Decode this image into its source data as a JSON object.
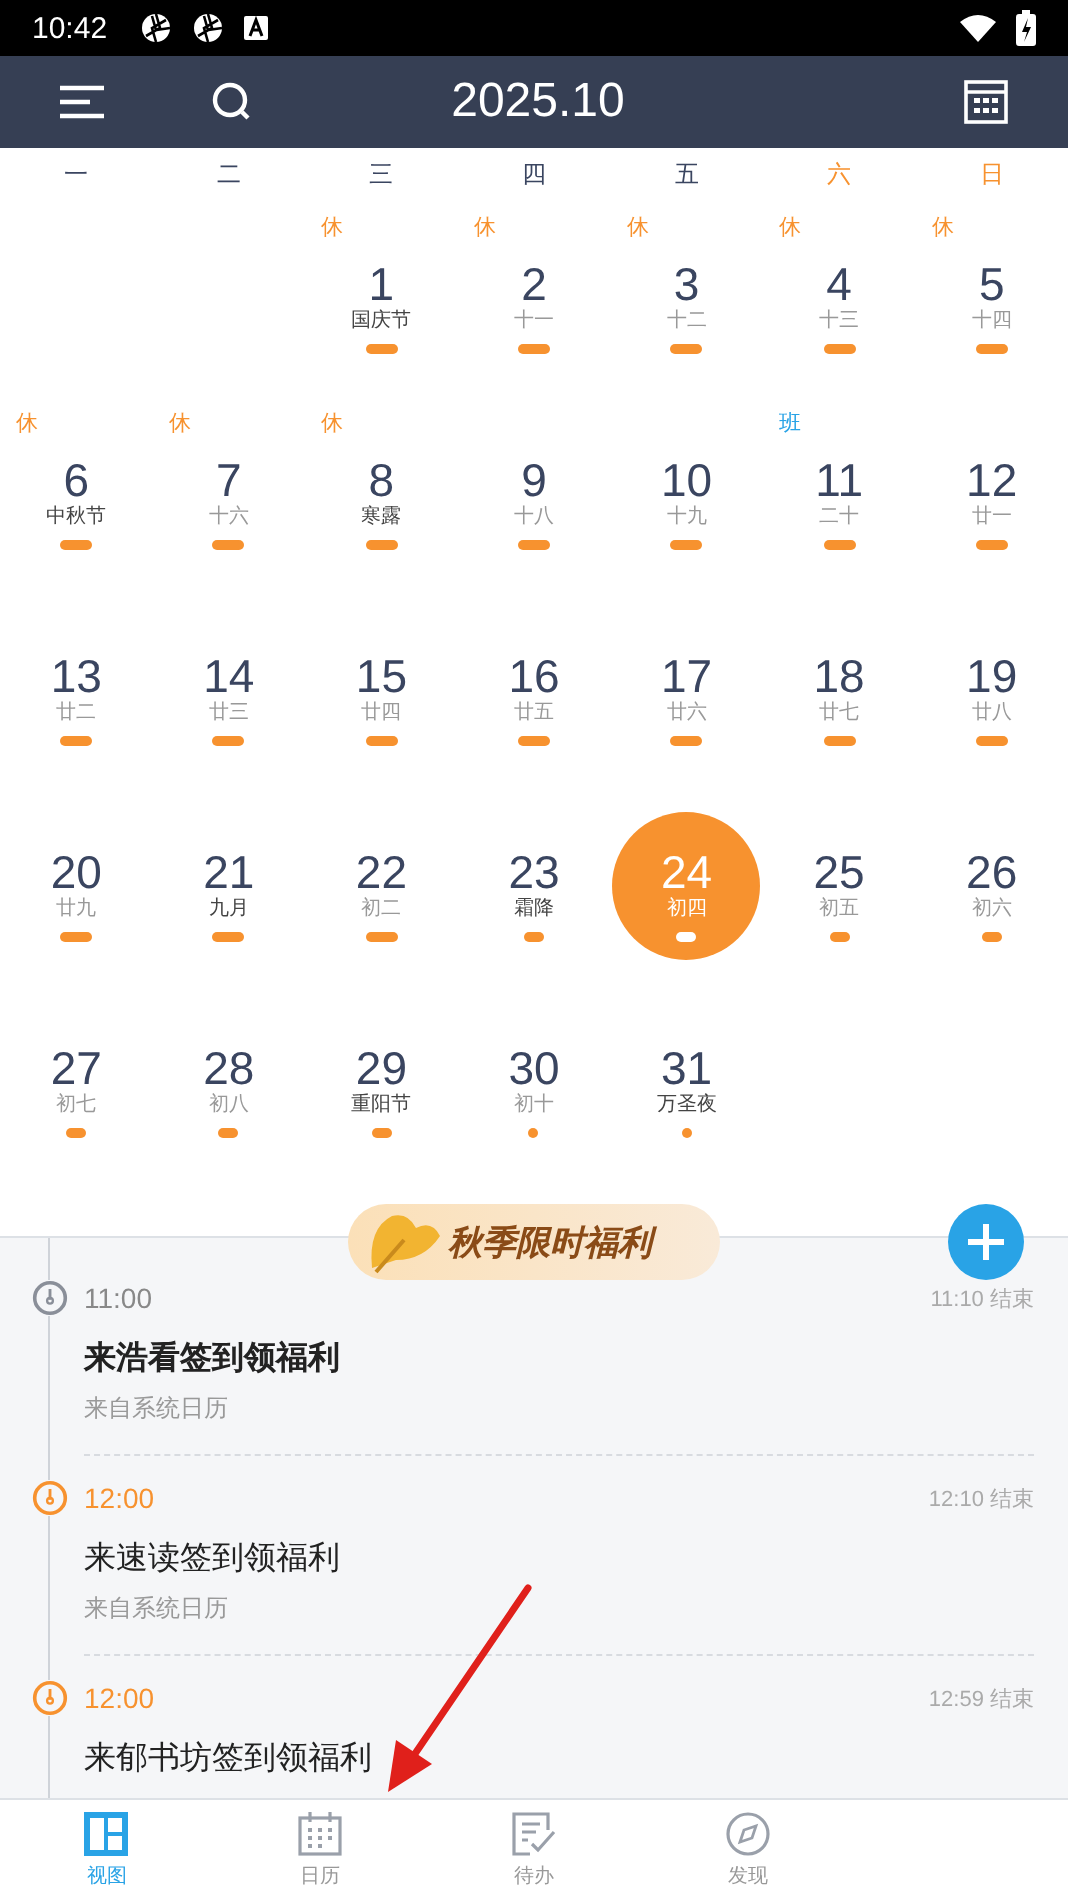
{
  "status_bar": {
    "time": "10:42"
  },
  "header": {
    "title": "2025.10"
  },
  "weekdays": [
    {
      "label": "一",
      "weekend": false
    },
    {
      "label": "二",
      "weekend": false
    },
    {
      "label": "三",
      "weekend": false
    },
    {
      "label": "四",
      "weekend": false
    },
    {
      "label": "五",
      "weekend": false
    },
    {
      "label": "六",
      "weekend": true
    },
    {
      "label": "日",
      "weekend": true
    }
  ],
  "weeks": [
    [
      {
        "day": "1",
        "lunar": "国庆节",
        "festival": true,
        "tag": {
          "text": "休",
          "color": "#f7922f"
        },
        "kind": "long",
        "selected": false
      },
      {
        "day": "2",
        "lunar": "十一",
        "festival": false,
        "tag": {
          "text": "休",
          "color": "#f7922f"
        },
        "kind": "long",
        "selected": false
      },
      {
        "day": "3",
        "lunar": "十二",
        "festival": false,
        "tag": {
          "text": "休",
          "color": "#f7922f"
        },
        "kind": "long",
        "selected": false
      },
      {
        "day": "4",
        "lunar": "十三",
        "festival": false,
        "tag": {
          "text": "休",
          "color": "#f7922f"
        },
        "kind": "long",
        "selected": false
      },
      {
        "day": "5",
        "lunar": "十四",
        "festival": false,
        "tag": {
          "text": "休",
          "color": "#f7922f"
        },
        "kind": "long",
        "selected": false
      }
    ],
    [
      {
        "day": "6",
        "lunar": "中秋节",
        "festival": true,
        "tag": {
          "text": "休",
          "color": "#f7922f"
        },
        "kind": "long",
        "selected": false
      },
      {
        "day": "7",
        "lunar": "十六",
        "festival": false,
        "tag": {
          "text": "休",
          "color": "#f7922f"
        },
        "kind": "long",
        "selected": false
      },
      {
        "day": "8",
        "lunar": "寒露",
        "festival": true,
        "tag": {
          "text": "休",
          "color": "#f7922f"
        },
        "kind": "long",
        "selected": false
      },
      {
        "day": "9",
        "lunar": "十八",
        "festival": false,
        "kind": "long",
        "selected": false
      },
      {
        "day": "10",
        "lunar": "十九",
        "festival": false,
        "kind": "long",
        "selected": false
      },
      {
        "day": "11",
        "lunar": "二十",
        "festival": false,
        "tag": {
          "text": "班",
          "color": "#29a3e6"
        },
        "kind": "long",
        "selected": false
      },
      {
        "day": "12",
        "lunar": "廿一",
        "festival": false,
        "kind": "long",
        "selected": false
      }
    ],
    [
      {
        "day": "13",
        "lunar": "廿二",
        "festival": false,
        "kind": "long",
        "selected": false
      },
      {
        "day": "14",
        "lunar": "廿三",
        "festival": false,
        "kind": "long",
        "selected": false
      },
      {
        "day": "15",
        "lunar": "廿四",
        "festival": false,
        "kind": "long",
        "selected": false
      },
      {
        "day": "16",
        "lunar": "廿五",
        "festival": false,
        "kind": "long",
        "selected": false
      },
      {
        "day": "17",
        "lunar": "廿六",
        "festival": false,
        "kind": "long",
        "selected": false
      },
      {
        "day": "18",
        "lunar": "廿七",
        "festival": false,
        "kind": "long",
        "selected": false
      },
      {
        "day": "19",
        "lunar": "廿八",
        "festival": false,
        "kind": "long",
        "selected": false
      }
    ],
    [
      {
        "day": "20",
        "lunar": "廿九",
        "festival": false,
        "kind": "long",
        "selected": false
      },
      {
        "day": "21",
        "lunar": "九月",
        "festival": true,
        "kind": "long",
        "selected": false
      },
      {
        "day": "22",
        "lunar": "初二",
        "festival": false,
        "kind": "long",
        "selected": false
      },
      {
        "day": "23",
        "lunar": "霜降",
        "festival": true,
        "kind": "short",
        "selected": false
      },
      {
        "day": "24",
        "lunar": "初四",
        "festival": false,
        "kind": "short",
        "selected": true
      },
      {
        "day": "25",
        "lunar": "初五",
        "festival": false,
        "kind": "short",
        "selected": false
      },
      {
        "day": "26",
        "lunar": "初六",
        "festival": false,
        "kind": "short",
        "selected": false
      }
    ],
    [
      {
        "day": "27",
        "lunar": "初七",
        "festival": false,
        "kind": "short",
        "selected": false
      },
      {
        "day": "28",
        "lunar": "初八",
        "festival": false,
        "kind": "short",
        "selected": false
      },
      {
        "day": "29",
        "lunar": "重阳节",
        "festival": true,
        "kind": "short",
        "selected": false
      },
      {
        "day": "30",
        "lunar": "初十",
        "festival": false,
        "kind": "dot",
        "selected": false
      },
      {
        "day": "31",
        "lunar": "万圣夜",
        "festival": true,
        "kind": "dot",
        "selected": false
      }
    ]
  ],
  "banner": {
    "text": "秋季限时福利"
  },
  "events": [
    {
      "time": "11:00",
      "past": true,
      "end": "11:10 结束",
      "title": "来浩看签到领福利",
      "source": "来自系统日历"
    },
    {
      "time": "12:00",
      "past": false,
      "end": "12:10 结束",
      "title": "来速读签到领福利",
      "source": "来自系统日历"
    },
    {
      "time": "12:00",
      "past": false,
      "end": "12:59 结束",
      "title": "来郁书坊签到领福利"
    }
  ],
  "bottom_nav": [
    {
      "label": "视图",
      "selected": true
    },
    {
      "label": "日历",
      "selected": false
    },
    {
      "label": "待办",
      "selected": false
    },
    {
      "label": "发现",
      "selected": false
    }
  ]
}
